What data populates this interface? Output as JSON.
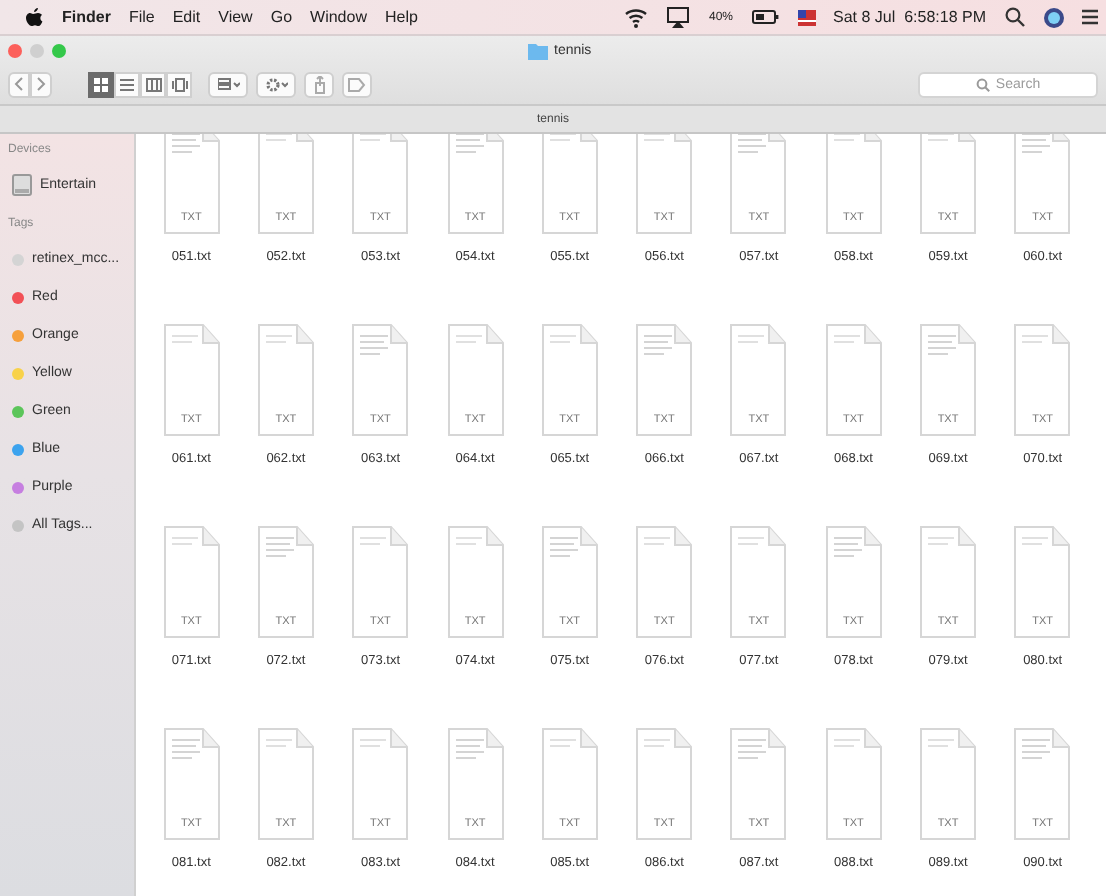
{
  "menu_bar": {
    "app": "Finder",
    "items": [
      "File",
      "Edit",
      "View",
      "Go",
      "Window",
      "Help"
    ],
    "battery": "40%",
    "clock": "Sat 8 Jul  6:58:18 PM"
  },
  "window": {
    "title": "tennis",
    "search": {
      "placeholder": "Search"
    },
    "path": "tennis",
    "view_modes": [
      {
        "kind": "icons",
        "selected": true
      },
      {
        "kind": "list",
        "selected": false
      },
      {
        "kind": "columns",
        "selected": false
      },
      {
        "kind": "cover",
        "selected": false
      }
    ]
  },
  "sidebar": {
    "sections": [
      {
        "title": "Devices",
        "items": [
          {
            "kind": "drive",
            "label": "Entertain"
          }
        ]
      },
      {
        "title": "Tags",
        "items": [
          {
            "kind": "tag",
            "label": "retinex_mcc...",
            "color": "#d4d4d4"
          },
          {
            "kind": "tag",
            "label": "Red",
            "color": "#f25056"
          },
          {
            "kind": "tag",
            "label": "Orange",
            "color": "#f6a03c"
          },
          {
            "kind": "tag",
            "label": "Yellow",
            "color": "#f8d24a"
          },
          {
            "kind": "tag",
            "label": "Green",
            "color": "#5cc55a"
          },
          {
            "kind": "tag",
            "label": "Blue",
            "color": "#3ca3ee"
          },
          {
            "kind": "tag",
            "label": "Purple",
            "color": "#c67fe0"
          },
          {
            "kind": "tag",
            "label": "All Tags...",
            "color": "#c4c4c4"
          }
        ]
      }
    ]
  },
  "files": [
    {
      "name": "051.txt",
      "badge": "TXT"
    },
    {
      "name": "052.txt",
      "badge": "TXT"
    },
    {
      "name": "053.txt",
      "badge": "TXT"
    },
    {
      "name": "054.txt",
      "badge": "TXT"
    },
    {
      "name": "055.txt",
      "badge": "TXT"
    },
    {
      "name": "056.txt",
      "badge": "TXT"
    },
    {
      "name": "057.txt",
      "badge": "TXT"
    },
    {
      "name": "058.txt",
      "badge": "TXT"
    },
    {
      "name": "059.txt",
      "badge": "TXT"
    },
    {
      "name": "060.txt",
      "badge": "TXT"
    },
    {
      "name": "061.txt",
      "badge": "TXT"
    },
    {
      "name": "062.txt",
      "badge": "TXT"
    },
    {
      "name": "063.txt",
      "badge": "TXT"
    },
    {
      "name": "064.txt",
      "badge": "TXT"
    },
    {
      "name": "065.txt",
      "badge": "TXT"
    },
    {
      "name": "066.txt",
      "badge": "TXT"
    },
    {
      "name": "067.txt",
      "badge": "TXT"
    },
    {
      "name": "068.txt",
      "badge": "TXT"
    },
    {
      "name": "069.txt",
      "badge": "TXT"
    },
    {
      "name": "070.txt",
      "badge": "TXT"
    },
    {
      "name": "071.txt",
      "badge": "TXT"
    },
    {
      "name": "072.txt",
      "badge": "TXT"
    },
    {
      "name": "073.txt",
      "badge": "TXT"
    },
    {
      "name": "074.txt",
      "badge": "TXT"
    },
    {
      "name": "075.txt",
      "badge": "TXT"
    },
    {
      "name": "076.txt",
      "badge": "TXT"
    },
    {
      "name": "077.txt",
      "badge": "TXT"
    },
    {
      "name": "078.txt",
      "badge": "TXT"
    },
    {
      "name": "079.txt",
      "badge": "TXT"
    },
    {
      "name": "080.txt",
      "badge": "TXT"
    },
    {
      "name": "081.txt",
      "badge": "TXT"
    },
    {
      "name": "082.txt",
      "badge": "TXT"
    },
    {
      "name": "083.txt",
      "badge": "TXT"
    },
    {
      "name": "084.txt",
      "badge": "TXT"
    },
    {
      "name": "085.txt",
      "badge": "TXT"
    },
    {
      "name": "086.txt",
      "badge": "TXT"
    },
    {
      "name": "087.txt",
      "badge": "TXT"
    },
    {
      "name": "088.txt",
      "badge": "TXT"
    },
    {
      "name": "089.txt",
      "badge": "TXT"
    },
    {
      "name": "090.txt",
      "badge": "TXT"
    }
  ]
}
